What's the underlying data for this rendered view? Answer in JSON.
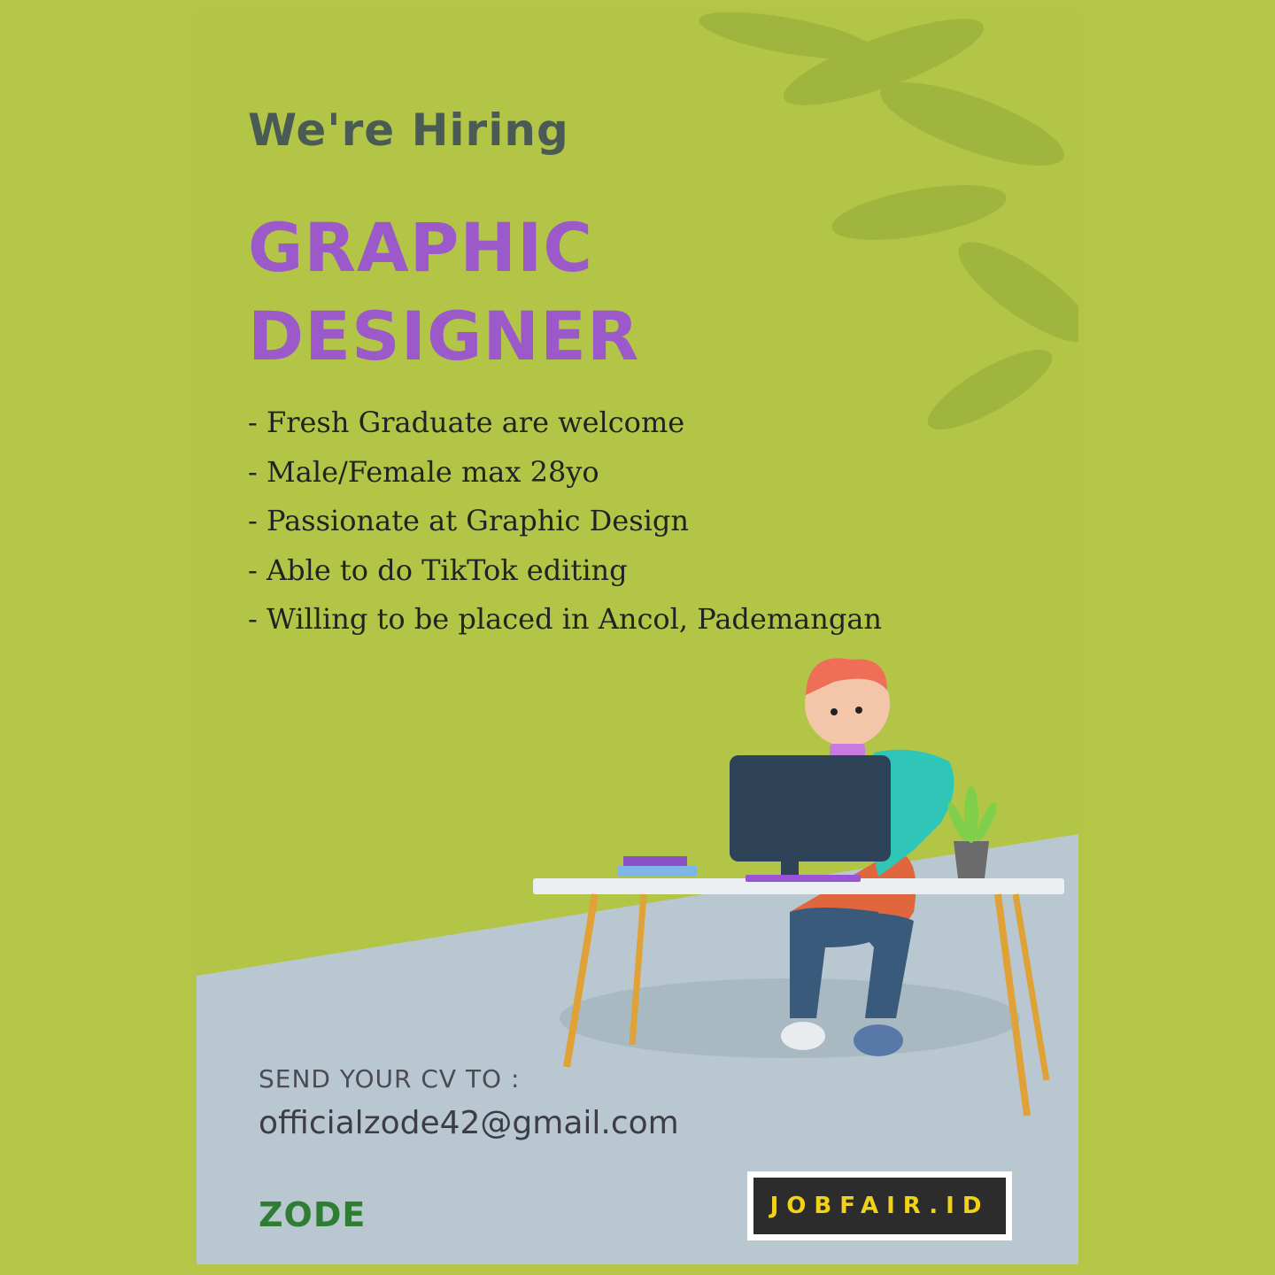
{
  "poster": {
    "headline": "We're Hiring",
    "title_line1": "GRAPHIC",
    "title_line2": "DESIGNER",
    "requirements": [
      "- Fresh Graduate are welcome",
      "- Male/Female max 28yo",
      "- Passionate at Graphic Design",
      "- Able to do TikTok editing",
      "- Willing to be placed in Ancol, Pademangan"
    ],
    "send_label": "SEND YOUR CV TO :",
    "email": "officialzode42@gmail.com",
    "brand": "ZODE"
  },
  "badge": {
    "text": "JOBFAIR.ID"
  },
  "colors": {
    "background": "#b5c548",
    "title": "#9b59c9",
    "floor": "#b9c8d0",
    "brand": "#2e7d32",
    "badge_text": "#f1d21a"
  },
  "icons": [
    "leaves-shadow",
    "designer-at-desk-illustration"
  ]
}
